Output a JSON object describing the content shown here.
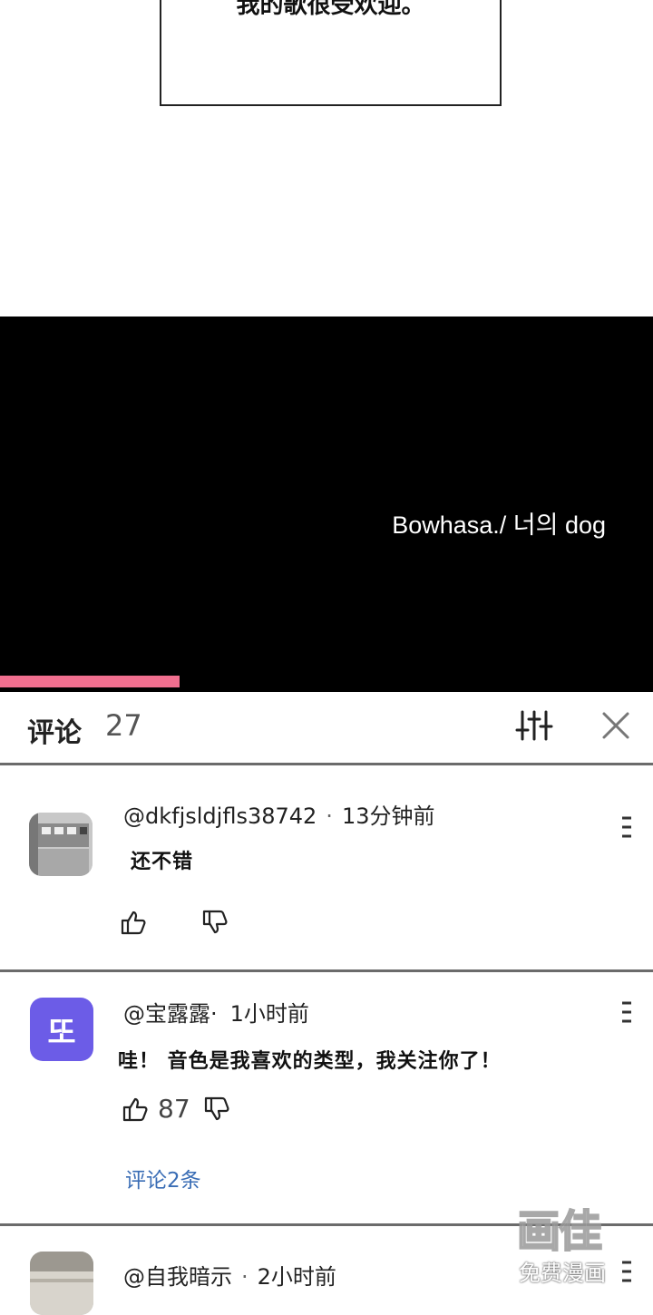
{
  "comic": {
    "speech_text": "我的歌很受欢迎。"
  },
  "video": {
    "caption": "Bowhasa./ 너의 dog",
    "progress": 0.275,
    "progress_color": "#f06f8f"
  },
  "comments_header": {
    "title": "评论",
    "count": "27",
    "filter_icon": "sliders-icon",
    "close_icon": "close-icon"
  },
  "comments": [
    {
      "username": "@dkfjsldjfls38742",
      "time": "13分钟前",
      "text": "还不错",
      "likes": "",
      "avatar": "photo"
    },
    {
      "username": "@宝露露·",
      "time": "1小时前",
      "text": "哇！ 音色是我喜欢的类型，我关注你了！",
      "likes": "87",
      "replies": "评论2条",
      "avatar_letter": "또",
      "avatar_color": "#6c5ce7"
    },
    {
      "username": "@自我暗示",
      "time": "2小时前",
      "text": "",
      "avatar": "photo"
    }
  ],
  "watermark": {
    "logo": "画佳",
    "text": "免费漫画"
  },
  "colors": {
    "reply_link": "#3a6db5",
    "divider": "#6b6b6b"
  }
}
